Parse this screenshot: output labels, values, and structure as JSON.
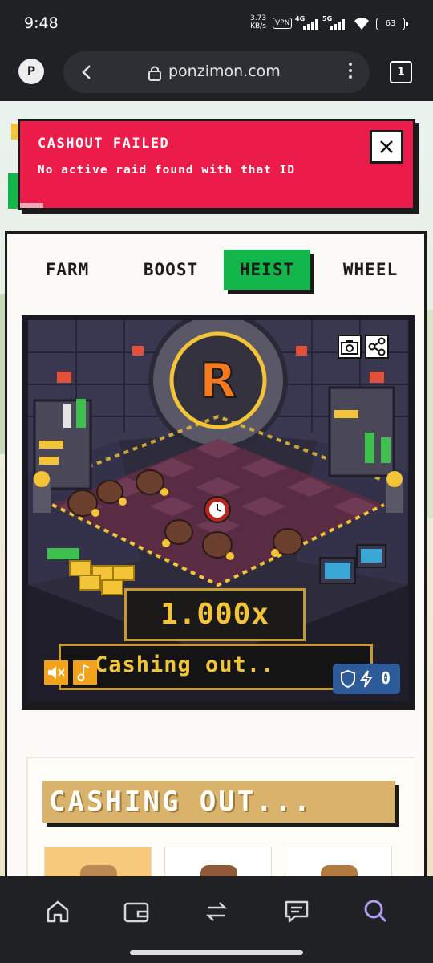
{
  "status_bar": {
    "time": "9:48",
    "speed_value": "3.73",
    "speed_unit": "KB/s",
    "vpn": "VPN",
    "net1": "4G",
    "net2": "5G",
    "battery": "63"
  },
  "browser": {
    "profile_letter": "P",
    "url": "ponzimon.com",
    "tab_count": "1"
  },
  "toast": {
    "title": "CASHOUT FAILED",
    "message": "No active raid found with that ID",
    "progress_fraction": 0.06
  },
  "nav": {
    "tabs": [
      {
        "label": "FARM",
        "active": false
      },
      {
        "label": "BOOST",
        "active": false
      },
      {
        "label": "HEIST",
        "active": true
      },
      {
        "label": "WHEEL",
        "active": false
      }
    ]
  },
  "game": {
    "vault_letter": "R",
    "multiplier": "1.000x",
    "status_text": "Cashing out..",
    "shield_count": "0"
  },
  "cashout_section": {
    "banner": "CASHING OUT..."
  },
  "colors": {
    "toast_red": "#ec1c4a",
    "active_tab_green": "#12b64a",
    "gold": "#f3c437",
    "banner_tan": "#d9b36b",
    "shield_blue": "#2d5a98"
  },
  "icons": [
    "back-icon",
    "lock-icon",
    "more-icon",
    "close-icon",
    "camera-icon",
    "share-icon",
    "mute-icon",
    "music-icon",
    "shield-icon",
    "bolt-icon",
    "home-icon",
    "wallet-icon",
    "swap-icon",
    "chat-icon",
    "search-icon"
  ]
}
